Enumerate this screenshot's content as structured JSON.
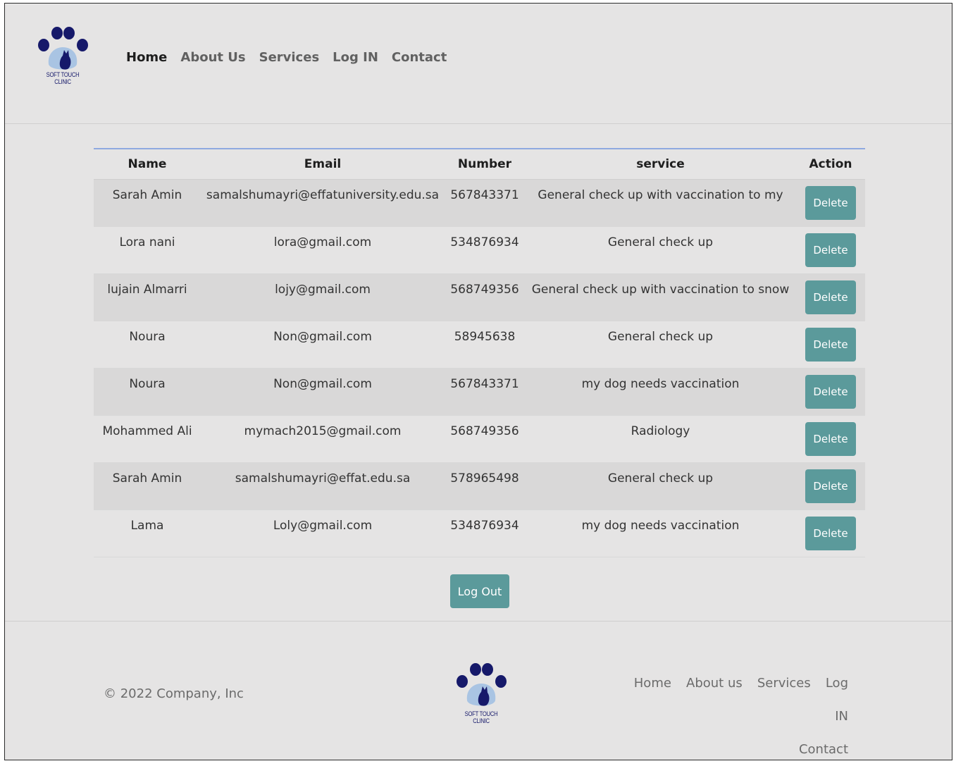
{
  "brand": {
    "logo_text": "SOFT TOUCH CLINIC",
    "logo_color": "#16196a",
    "accent": "#5b9a9b"
  },
  "nav": {
    "items": [
      {
        "label": "Home"
      },
      {
        "label": "About Us"
      },
      {
        "label": "Services"
      },
      {
        "label": "Log IN"
      },
      {
        "label": "Contact"
      }
    ]
  },
  "table": {
    "headers": [
      "Name",
      "Email",
      "Number",
      "service",
      "Action"
    ],
    "rows": [
      {
        "name": "Sarah Amin",
        "email": "samalshumayri@effatuniversity.edu.sa",
        "number": "567843371",
        "service": "General check up with vaccination to my",
        "action": "Delete"
      },
      {
        "name": "Lora nani",
        "email": "lora@gmail.com",
        "number": "534876934",
        "service": "General check up",
        "action": "Delete"
      },
      {
        "name": "lujain Almarri",
        "email": "lojy@gmail.com",
        "number": "568749356",
        "service": "General check up with vaccination to snow",
        "action": "Delete"
      },
      {
        "name": "Noura",
        "email": "Non@gmail.com",
        "number": "58945638",
        "service": "General check up",
        "action": "Delete"
      },
      {
        "name": "Noura",
        "email": "Non@gmail.com",
        "number": "567843371",
        "service": "my dog needs vaccination",
        "action": "Delete"
      },
      {
        "name": "Mohammed Ali",
        "email": "mymach2015@gmail.com",
        "number": "568749356",
        "service": "Radiology",
        "action": "Delete"
      },
      {
        "name": "Sarah Amin",
        "email": "samalshumayri@effat.edu.sa",
        "number": "578965498",
        "service": "General check up",
        "action": "Delete"
      },
      {
        "name": "Lama",
        "email": "Loly@gmail.com",
        "number": "534876934",
        "service": "my dog needs vaccination",
        "action": "Delete"
      }
    ]
  },
  "logout_label": "Log Out",
  "footer": {
    "copyright": "© 2022 Company, Inc",
    "links": [
      {
        "label": "Home"
      },
      {
        "label": "About us"
      },
      {
        "label": "Services"
      },
      {
        "label": "Log IN"
      },
      {
        "label": "Contact"
      }
    ]
  }
}
